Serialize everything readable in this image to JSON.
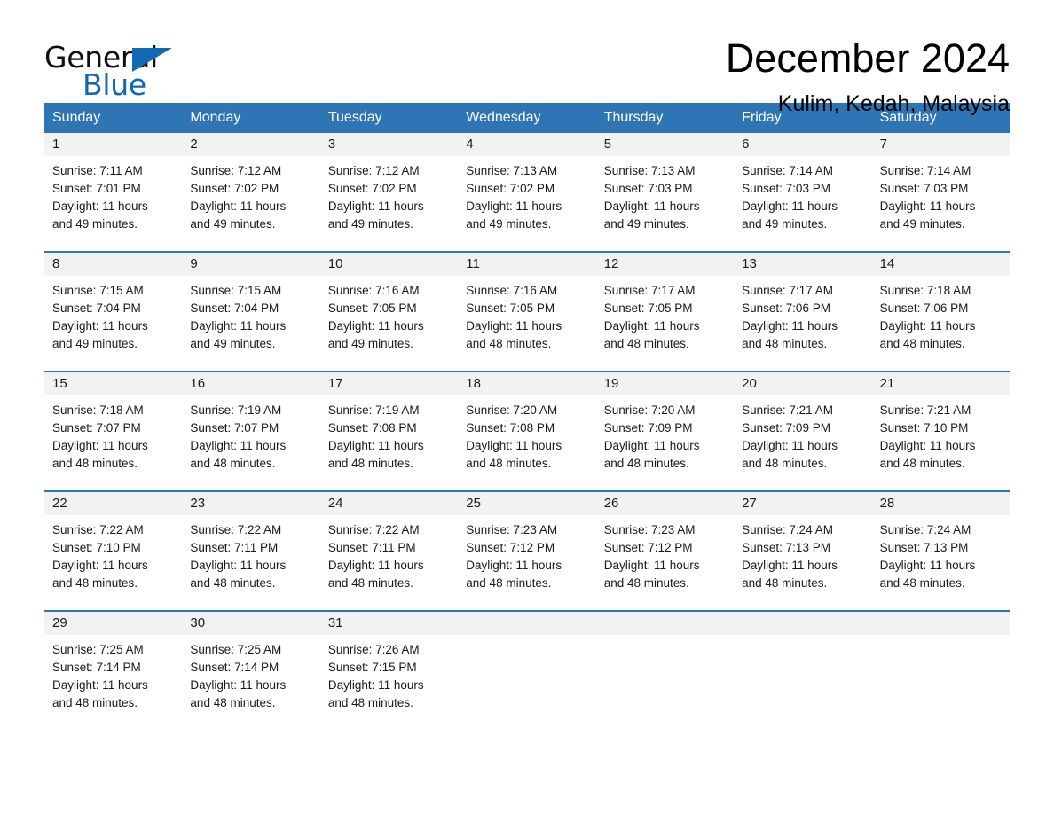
{
  "brand": {
    "line1": "General",
    "line2": "Blue",
    "flag_icon": "triangle-flag-icon",
    "accent_color": "#1268b3"
  },
  "header": {
    "title": "December 2024",
    "location": "Kulim, Kedah, Malaysia"
  },
  "theme": {
    "header_bar_color": "#2e75b6",
    "day_band_color": "#f2f2f2",
    "text_color": "#1a1a1a"
  },
  "weekdays": [
    "Sunday",
    "Monday",
    "Tuesday",
    "Wednesday",
    "Thursday",
    "Friday",
    "Saturday"
  ],
  "labels": {
    "sunrise_prefix": "Sunrise:",
    "sunset_prefix": "Sunset:",
    "daylight_prefix": "Daylight:"
  },
  "weeks": [
    [
      {
        "day": "1",
        "sunrise": "Sunrise: 7:11 AM",
        "sunset": "Sunset: 7:01 PM",
        "daylight_line1": "Daylight: 11 hours",
        "daylight_line2": "and 49 minutes."
      },
      {
        "day": "2",
        "sunrise": "Sunrise: 7:12 AM",
        "sunset": "Sunset: 7:02 PM",
        "daylight_line1": "Daylight: 11 hours",
        "daylight_line2": "and 49 minutes."
      },
      {
        "day": "3",
        "sunrise": "Sunrise: 7:12 AM",
        "sunset": "Sunset: 7:02 PM",
        "daylight_line1": "Daylight: 11 hours",
        "daylight_line2": "and 49 minutes."
      },
      {
        "day": "4",
        "sunrise": "Sunrise: 7:13 AM",
        "sunset": "Sunset: 7:02 PM",
        "daylight_line1": "Daylight: 11 hours",
        "daylight_line2": "and 49 minutes."
      },
      {
        "day": "5",
        "sunrise": "Sunrise: 7:13 AM",
        "sunset": "Sunset: 7:03 PM",
        "daylight_line1": "Daylight: 11 hours",
        "daylight_line2": "and 49 minutes."
      },
      {
        "day": "6",
        "sunrise": "Sunrise: 7:14 AM",
        "sunset": "Sunset: 7:03 PM",
        "daylight_line1": "Daylight: 11 hours",
        "daylight_line2": "and 49 minutes."
      },
      {
        "day": "7",
        "sunrise": "Sunrise: 7:14 AM",
        "sunset": "Sunset: 7:03 PM",
        "daylight_line1": "Daylight: 11 hours",
        "daylight_line2": "and 49 minutes."
      }
    ],
    [
      {
        "day": "8",
        "sunrise": "Sunrise: 7:15 AM",
        "sunset": "Sunset: 7:04 PM",
        "daylight_line1": "Daylight: 11 hours",
        "daylight_line2": "and 49 minutes."
      },
      {
        "day": "9",
        "sunrise": "Sunrise: 7:15 AM",
        "sunset": "Sunset: 7:04 PM",
        "daylight_line1": "Daylight: 11 hours",
        "daylight_line2": "and 49 minutes."
      },
      {
        "day": "10",
        "sunrise": "Sunrise: 7:16 AM",
        "sunset": "Sunset: 7:05 PM",
        "daylight_line1": "Daylight: 11 hours",
        "daylight_line2": "and 49 minutes."
      },
      {
        "day": "11",
        "sunrise": "Sunrise: 7:16 AM",
        "sunset": "Sunset: 7:05 PM",
        "daylight_line1": "Daylight: 11 hours",
        "daylight_line2": "and 48 minutes."
      },
      {
        "day": "12",
        "sunrise": "Sunrise: 7:17 AM",
        "sunset": "Sunset: 7:05 PM",
        "daylight_line1": "Daylight: 11 hours",
        "daylight_line2": "and 48 minutes."
      },
      {
        "day": "13",
        "sunrise": "Sunrise: 7:17 AM",
        "sunset": "Sunset: 7:06 PM",
        "daylight_line1": "Daylight: 11 hours",
        "daylight_line2": "and 48 minutes."
      },
      {
        "day": "14",
        "sunrise": "Sunrise: 7:18 AM",
        "sunset": "Sunset: 7:06 PM",
        "daylight_line1": "Daylight: 11 hours",
        "daylight_line2": "and 48 minutes."
      }
    ],
    [
      {
        "day": "15",
        "sunrise": "Sunrise: 7:18 AM",
        "sunset": "Sunset: 7:07 PM",
        "daylight_line1": "Daylight: 11 hours",
        "daylight_line2": "and 48 minutes."
      },
      {
        "day": "16",
        "sunrise": "Sunrise: 7:19 AM",
        "sunset": "Sunset: 7:07 PM",
        "daylight_line1": "Daylight: 11 hours",
        "daylight_line2": "and 48 minutes."
      },
      {
        "day": "17",
        "sunrise": "Sunrise: 7:19 AM",
        "sunset": "Sunset: 7:08 PM",
        "daylight_line1": "Daylight: 11 hours",
        "daylight_line2": "and 48 minutes."
      },
      {
        "day": "18",
        "sunrise": "Sunrise: 7:20 AM",
        "sunset": "Sunset: 7:08 PM",
        "daylight_line1": "Daylight: 11 hours",
        "daylight_line2": "and 48 minutes."
      },
      {
        "day": "19",
        "sunrise": "Sunrise: 7:20 AM",
        "sunset": "Sunset: 7:09 PM",
        "daylight_line1": "Daylight: 11 hours",
        "daylight_line2": "and 48 minutes."
      },
      {
        "day": "20",
        "sunrise": "Sunrise: 7:21 AM",
        "sunset": "Sunset: 7:09 PM",
        "daylight_line1": "Daylight: 11 hours",
        "daylight_line2": "and 48 minutes."
      },
      {
        "day": "21",
        "sunrise": "Sunrise: 7:21 AM",
        "sunset": "Sunset: 7:10 PM",
        "daylight_line1": "Daylight: 11 hours",
        "daylight_line2": "and 48 minutes."
      }
    ],
    [
      {
        "day": "22",
        "sunrise": "Sunrise: 7:22 AM",
        "sunset": "Sunset: 7:10 PM",
        "daylight_line1": "Daylight: 11 hours",
        "daylight_line2": "and 48 minutes."
      },
      {
        "day": "23",
        "sunrise": "Sunrise: 7:22 AM",
        "sunset": "Sunset: 7:11 PM",
        "daylight_line1": "Daylight: 11 hours",
        "daylight_line2": "and 48 minutes."
      },
      {
        "day": "24",
        "sunrise": "Sunrise: 7:22 AM",
        "sunset": "Sunset: 7:11 PM",
        "daylight_line1": "Daylight: 11 hours",
        "daylight_line2": "and 48 minutes."
      },
      {
        "day": "25",
        "sunrise": "Sunrise: 7:23 AM",
        "sunset": "Sunset: 7:12 PM",
        "daylight_line1": "Daylight: 11 hours",
        "daylight_line2": "and 48 minutes."
      },
      {
        "day": "26",
        "sunrise": "Sunrise: 7:23 AM",
        "sunset": "Sunset: 7:12 PM",
        "daylight_line1": "Daylight: 11 hours",
        "daylight_line2": "and 48 minutes."
      },
      {
        "day": "27",
        "sunrise": "Sunrise: 7:24 AM",
        "sunset": "Sunset: 7:13 PM",
        "daylight_line1": "Daylight: 11 hours",
        "daylight_line2": "and 48 minutes."
      },
      {
        "day": "28",
        "sunrise": "Sunrise: 7:24 AM",
        "sunset": "Sunset: 7:13 PM",
        "daylight_line1": "Daylight: 11 hours",
        "daylight_line2": "and 48 minutes."
      }
    ],
    [
      {
        "day": "29",
        "sunrise": "Sunrise: 7:25 AM",
        "sunset": "Sunset: 7:14 PM",
        "daylight_line1": "Daylight: 11 hours",
        "daylight_line2": "and 48 minutes."
      },
      {
        "day": "30",
        "sunrise": "Sunrise: 7:25 AM",
        "sunset": "Sunset: 7:14 PM",
        "daylight_line1": "Daylight: 11 hours",
        "daylight_line2": "and 48 minutes."
      },
      {
        "day": "31",
        "sunrise": "Sunrise: 7:26 AM",
        "sunset": "Sunset: 7:15 PM",
        "daylight_line1": "Daylight: 11 hours",
        "daylight_line2": "and 48 minutes."
      },
      {
        "day": "",
        "sunrise": "",
        "sunset": "",
        "daylight_line1": "",
        "daylight_line2": ""
      },
      {
        "day": "",
        "sunrise": "",
        "sunset": "",
        "daylight_line1": "",
        "daylight_line2": ""
      },
      {
        "day": "",
        "sunrise": "",
        "sunset": "",
        "daylight_line1": "",
        "daylight_line2": ""
      },
      {
        "day": "",
        "sunrise": "",
        "sunset": "",
        "daylight_line1": "",
        "daylight_line2": ""
      }
    ]
  ]
}
